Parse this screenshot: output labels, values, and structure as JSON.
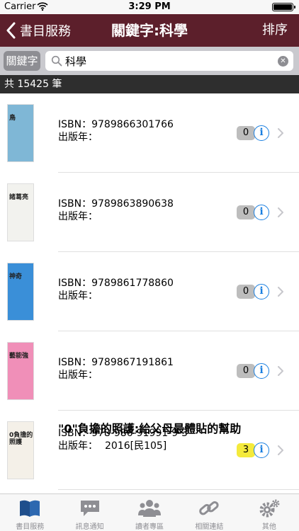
{
  "status_bar": {
    "carrier": "Carrier",
    "time": "3:29 PM"
  },
  "nav": {
    "back_label": "書目服務",
    "title": "關鍵字:科學",
    "sort_label": "排序"
  },
  "search": {
    "chip_label": "關鍵字",
    "value": "科學"
  },
  "result_count": "共 15425 筆",
  "books": [
    {
      "title": "",
      "isbn": "ISBN：9789866301766",
      "year_label": "出版年：",
      "year": "",
      "count": "0",
      "cover_color": "#7fb7d6",
      "cover_text": "鳥"
    },
    {
      "title": "",
      "isbn": "ISBN：9789863890638",
      "year_label": "出版年：",
      "year": "",
      "count": "0",
      "cover_color": "#f2f2ee",
      "cover_text": "諸葛亮"
    },
    {
      "title": "",
      "isbn": "ISBN：9789861778860",
      "year_label": "出版年：",
      "year": "",
      "count": "0",
      "cover_color": "#3a8fd8",
      "cover_text": "神奇"
    },
    {
      "title": "",
      "isbn": "ISBN：9789867191861",
      "year_label": "出版年：",
      "year": "",
      "count": "0",
      "cover_color": "#f08fb8",
      "cover_text": "藝能強"
    },
    {
      "title": "\"0\"負擔的照護:給父母最體貼的幫助",
      "isbn": "ISBN：978-986-91991-9-3",
      "year_label": "出版年：",
      "year": "2016[民105]",
      "count": "3",
      "cover_color": "#f4f0e8",
      "cover_text": "0負擔的照護"
    }
  ],
  "tabs": [
    {
      "label": "書目服務",
      "icon": "book-icon",
      "active": true
    },
    {
      "label": "訊息通知",
      "icon": "chat-icon",
      "active": false
    },
    {
      "label": "讀者專區",
      "icon": "people-icon",
      "active": false
    },
    {
      "label": "相關連結",
      "icon": "link-icon",
      "active": false
    },
    {
      "label": "其他",
      "icon": "gear-icon",
      "active": false
    }
  ],
  "colors": {
    "nav_bg": "#5c1f2b",
    "info_blue": "#1a7fe0",
    "badge_grey": "#bdbdbd",
    "badge_yellow": "#f4ea3c",
    "tab_active": "#1f4f8c"
  }
}
